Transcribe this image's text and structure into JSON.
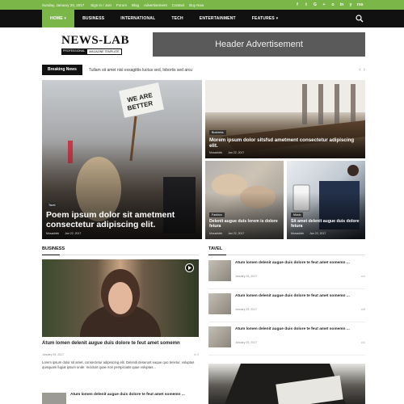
{
  "topbar": {
    "date": "Sunday, January 29, 2017",
    "links": [
      "Sign in / Join",
      "Forum",
      "Blog",
      "Advertisement",
      "Contact",
      "Buy Now"
    ],
    "social": [
      "f",
      "t",
      "G",
      "+",
      "o",
      "in",
      "y",
      "rss"
    ]
  },
  "nav": {
    "items": [
      "HOME",
      "BUSINESS",
      "INTERNATIONAL",
      "TECH",
      "ENTERTAINMENT",
      "FEATURES"
    ],
    "active_index": 0
  },
  "logo": {
    "name": "NEWS-LAB",
    "tag1": "PROFESSIONAL",
    "tag2": "MAGAZINE TEMPLATE"
  },
  "header_ad": "Header Advertisement",
  "breaking": {
    "label": "Breaking News",
    "text": "Tullam sit amet nisl exsagittis luctus sed, lobortis sed arcu",
    "prev": "‹",
    "next": "›"
  },
  "tiles": {
    "big": {
      "category": "Tavel",
      "title": "Poem ipsum dolor sit ametment consectetur adipiscing elit.",
      "author": "Mosaddek",
      "date": "Jan 22, 2017"
    },
    "board": {
      "category": "Business",
      "title": "Morem ipsum dolor sitsfsd ametment consectetur adipiscing elit.",
      "author": "Mosaddek",
      "date": "Jan 22, 2017"
    },
    "hands": {
      "category": "Fashion",
      "title": "Delenit augue duis lorem is dolore fetura",
      "author": "Mosaddek",
      "date": "Jan 22, 2017"
    },
    "phone": {
      "category": "Music",
      "title": "Sit amet delenit augue duis dolore fetura",
      "author": "Mosaddek",
      "date": "Jan 22, 2017"
    }
  },
  "business": {
    "heading": "BUSINESS",
    "title": "Atum lomen delenit augue duis dolore te feut amet somemn",
    "date": "January 25, 2017",
    "comments": "1",
    "excerpt": "Lorem ipsum dolor sit amet, consectetur adipisicing elit. Deleniti deserunt eaque quo tenetur, voluptas quisquam fugiat ipsum unde. Incidunt quae non perspiciatis quae voluptas...",
    "next_title": "Atum lomen delenit augue duis dolore te feut amet somemn ..."
  },
  "travel": {
    "heading": "TAVEL",
    "items": [
      {
        "title": "Atum lomen delenit augue duis dolore te feut amet somemn ...",
        "date": "January 25, 2017",
        "comments": "1"
      },
      {
        "title": "Atum lomen delenit augue duis dolore te feut amet somemn ...",
        "date": "January 25, 2017",
        "comments": "0"
      },
      {
        "title": "Atum lomen delenit augue duis dolore te feut amet somemn ...",
        "date": "January 25, 2017",
        "comments": "1"
      }
    ]
  },
  "colors": {
    "accent": "#7ab648",
    "nav_bg": "#111111",
    "ad_bg": "#5a5a5a"
  }
}
